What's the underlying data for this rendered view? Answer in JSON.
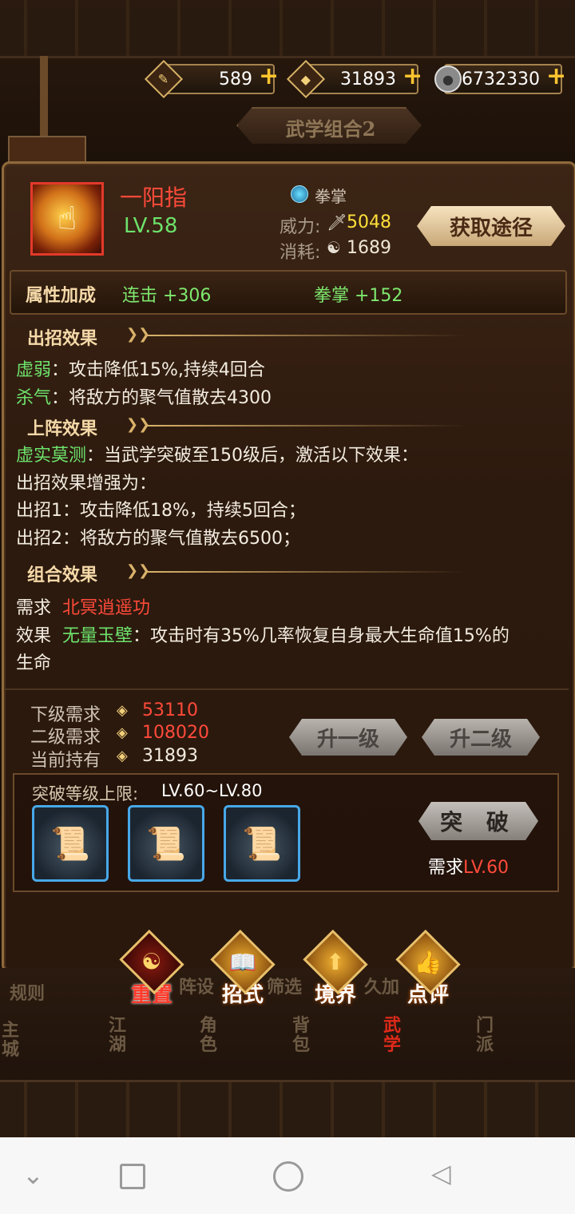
{
  "resources": [
    {
      "icon": "scroll-token-icon",
      "value": "589"
    },
    {
      "icon": "gold-coin-icon",
      "value": "31893"
    },
    {
      "icon": "silver-coin-icon",
      "value": "6732330"
    }
  ],
  "combo_tab": "武学组合2",
  "skill": {
    "name": "一阳指",
    "level": "LV.58",
    "type": "拳掌",
    "power_label": "威力:",
    "power_value": "5048",
    "cost_label": "消耗:",
    "cost_value": "1689",
    "get_button": "获取途径"
  },
  "attributes": {
    "label": "属性加成",
    "items": [
      "连击 +306",
      "拳掌 +152"
    ]
  },
  "cast_effect": {
    "title": "出招效果",
    "lines": [
      {
        "key": "虚弱",
        "text": "：攻击降低15%,持续4回合"
      },
      {
        "key": "杀气",
        "text": "：将敌方的聚气值散去4300"
      }
    ]
  },
  "formation_effect": {
    "title": "上阵效果",
    "key": "虚实莫测",
    "first": "：当武学突破至150级后，激活以下效果：",
    "lines": [
      "出招效果增强为：",
      "出招1：攻击降低18%，持续5回合；",
      "出招2：将敌方的聚气值散去6500；"
    ]
  },
  "combo_effect": {
    "title": "组合效果",
    "req_label": "需求",
    "req_value": "北冥逍遥功",
    "effect_label": "效果",
    "effect_key": "无量玉壁",
    "effect_text": "：攻击时有35%几率恢复自身最大生命值15%的",
    "effect_text2": "生命"
  },
  "upgrade": {
    "next_label": "下级需求",
    "next_value": "53110",
    "second_label": "二级需求",
    "second_value": "108020",
    "own_label": "当前持有",
    "own_value": "31893",
    "up1": "升一级",
    "up2": "升二级"
  },
  "breakthrough": {
    "label": "突破等级上限:",
    "range": "LV.60~LV.80",
    "button": "突 破",
    "req_label": "需求",
    "req_value": "LV.60"
  },
  "actions": [
    "重置",
    "招式",
    "境界",
    "点评"
  ],
  "bg_menu": {
    "rules": "规则",
    "formation": "阵设",
    "filter": "筛选",
    "bonus": "久加"
  },
  "nav": [
    "主城",
    "江湖",
    "角色",
    "背包",
    "武学",
    "门派"
  ]
}
